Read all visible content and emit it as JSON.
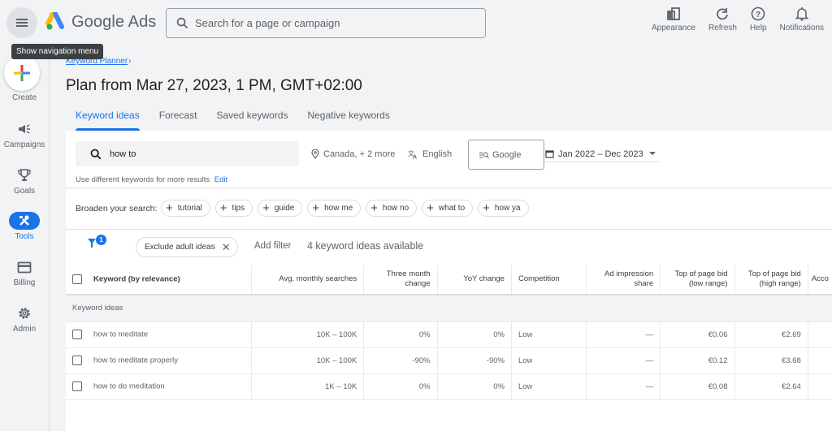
{
  "topbar": {
    "app_name": "Google Ads",
    "search_placeholder": "Search for a page or campaign",
    "tooltip": "Show navigation menu",
    "actions": [
      {
        "label": "Appearance",
        "icon": "appearance-icon"
      },
      {
        "label": "Refresh",
        "icon": "refresh-icon"
      },
      {
        "label": "Help",
        "icon": "help-icon"
      },
      {
        "label": "Notifications",
        "icon": "bell-icon"
      }
    ]
  },
  "sidenav": {
    "create_label": "Create",
    "items": [
      {
        "label": "Campaigns",
        "icon": "megaphone-icon"
      },
      {
        "label": "Goals",
        "icon": "trophy-icon"
      },
      {
        "label": "Tools",
        "icon": "tools-icon",
        "active": true
      },
      {
        "label": "Billing",
        "icon": "credit-card-icon"
      },
      {
        "label": "Admin",
        "icon": "gear-icon"
      }
    ]
  },
  "breadcrumb": {
    "label": "Keyword Planner",
    "chevron": "›"
  },
  "page_title": "Plan from Mar 27, 2023, 1 PM, GMT+02:00",
  "tabs": [
    {
      "label": "Keyword ideas",
      "active": true
    },
    {
      "label": "Forecast"
    },
    {
      "label": "Saved keywords"
    },
    {
      "label": "Negative keywords"
    }
  ],
  "search_panel": {
    "keyword_value": "how to",
    "hint": "Use different keywords for more results",
    "hint_link": "Edit",
    "location": "Canada, + 2 more",
    "language": "English",
    "network": "Google",
    "date_range": "Jan 2022 – Dec 2023"
  },
  "broaden": {
    "label": "Broaden your search:",
    "chips": [
      "tutorial",
      "tips",
      "guide",
      "how me",
      "how no",
      "what to",
      "how ya"
    ]
  },
  "filters": {
    "badge_count": "1",
    "active_filter": "Exclude adult ideas",
    "add_filter": "Add filter",
    "available": "4 keyword ideas available"
  },
  "table": {
    "headers": {
      "keyword": "Keyword (by relevance)",
      "avg": "Avg. monthly searches",
      "three_month": "Three month change",
      "yoy": "YoY change",
      "competition": "Competition",
      "ad_share": "Ad impression share",
      "bid_low": "Top of page bid (low range)",
      "bid_high": "Top of page bid (high range)",
      "acc": "Acco"
    },
    "group_label": "Keyword ideas",
    "rows": [
      {
        "keyword": "how to meditate",
        "avg": "10K – 100K",
        "three_month": "0%",
        "yoy": "0%",
        "competition": "Low",
        "ad_share": "—",
        "bid_low": "€0.06",
        "bid_high": "€2.69"
      },
      {
        "keyword": "how to meditate properly",
        "avg": "10K – 100K",
        "three_month": "-90%",
        "yoy": "-90%",
        "competition": "Low",
        "ad_share": "—",
        "bid_low": "€0.12",
        "bid_high": "€3.68"
      },
      {
        "keyword": "how to do meditation",
        "avg": "1K – 10K",
        "three_month": "0%",
        "yoy": "0%",
        "competition": "Low",
        "ad_share": "—",
        "bid_low": "€0.08",
        "bid_high": "€2.64"
      }
    ]
  }
}
